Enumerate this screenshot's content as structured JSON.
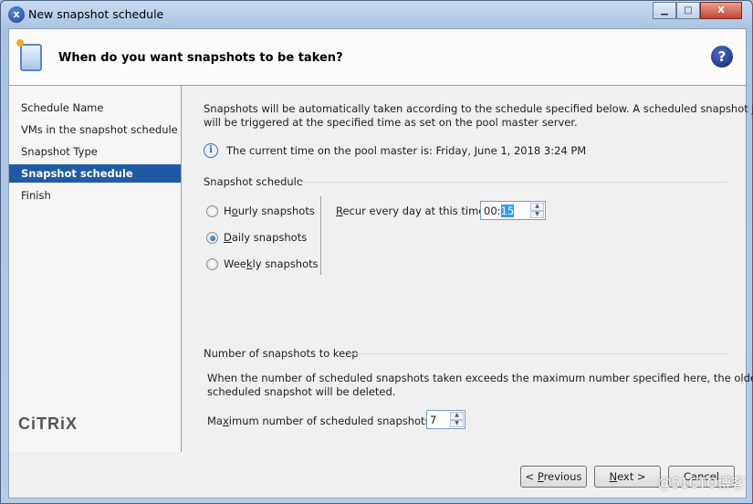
{
  "window": {
    "title": "New snapshot schedule",
    "app_icon": "xencenter-icon",
    "minimize": "minimize-icon",
    "maximize": "maximize-icon",
    "close": "close-icon"
  },
  "header": {
    "title": "When do you want snapshots to be taken?",
    "icon": "snapshot-schedule-icon",
    "help": "?"
  },
  "sidebar": {
    "items": [
      {
        "label": "Schedule Name",
        "selected": false
      },
      {
        "label": "VMs in the snapshot schedule",
        "selected": false
      },
      {
        "label": "Snapshot Type",
        "selected": false
      },
      {
        "label": "Snapshot schedule",
        "selected": true
      },
      {
        "label": "Finish",
        "selected": false
      }
    ],
    "logo": "CiTRiX"
  },
  "main": {
    "intro": "Snapshots will be automatically taken according to the schedule specified below. A scheduled snapshot job",
    "intro2": "will be triggered at the specified time as set on the pool master server.",
    "current_time": "The current time on the pool master is: Friday, June 1, 2018 3:24 PM",
    "schedule_group": "Snapshot schedule",
    "options": [
      {
        "pre": "H",
        "ul": "o",
        "post": "urly snapshots",
        "checked": false
      },
      {
        "pre": "",
        "ul": "D",
        "post": "aily snapshots",
        "checked": true
      },
      {
        "pre": "Wee",
        "ul": "k",
        "post": "ly snapshots",
        "checked": false
      }
    ],
    "recur": {
      "ul": "R",
      "post": "ecur every day at this time:",
      "hours": "00:",
      "minutes": "15"
    },
    "keep_group": "Number of snapshots to keep",
    "keep_desc": "When the number of scheduled snapshots taken exceeds the maximum number specified here, the oldest",
    "keep_desc2": "scheduled snapshot will be deleted.",
    "max": {
      "pre": "Ma",
      "ul": "x",
      "post": "imum number of scheduled snapshots:",
      "value": "7"
    }
  },
  "buttons": {
    "previous": {
      "pre": "< ",
      "ul": "P",
      "post": "revious"
    },
    "next": {
      "pre": "",
      "ul": "N",
      "post": "ext >"
    },
    "cancel": "Cancel"
  },
  "watermark": "@51CTO博客"
}
